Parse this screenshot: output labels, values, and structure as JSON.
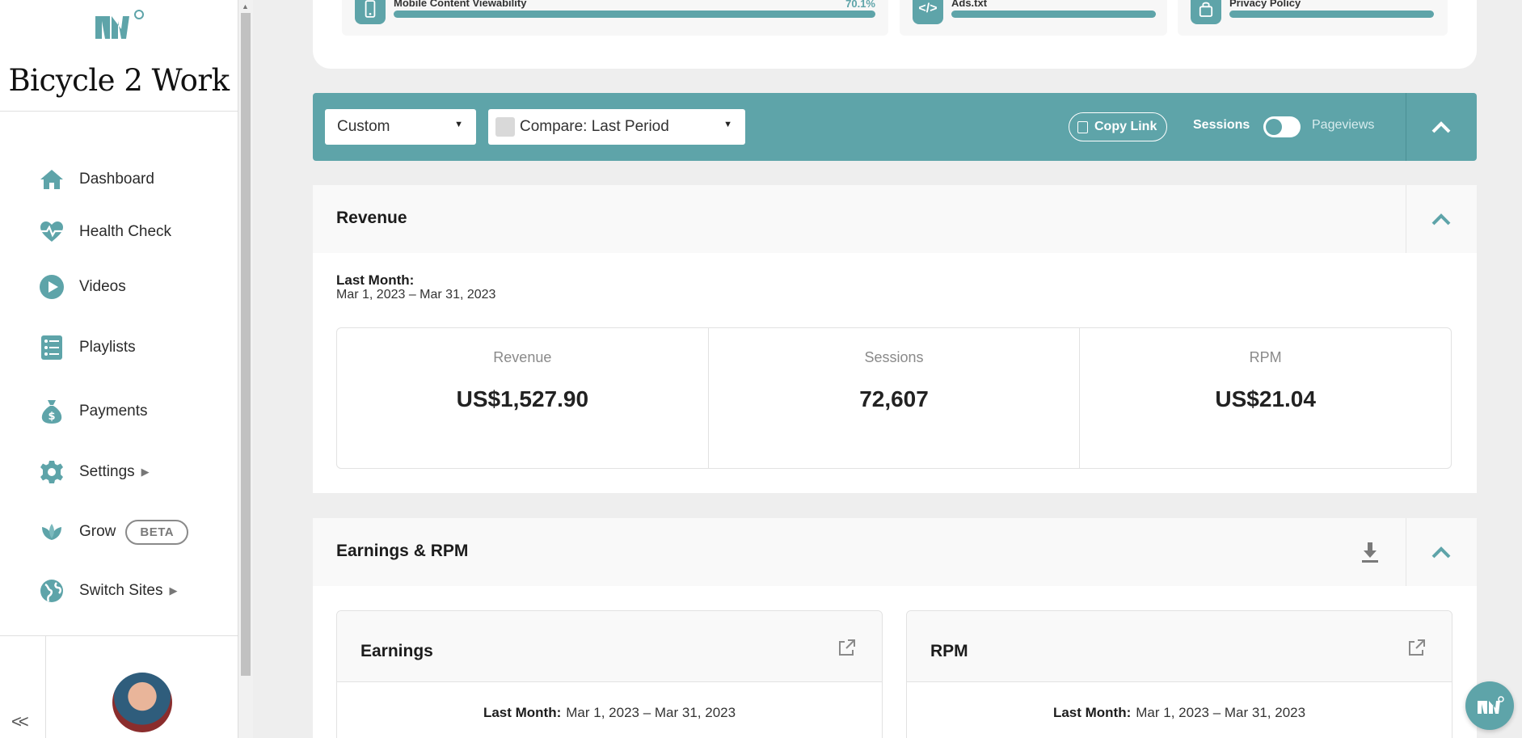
{
  "brand": {
    "name": "Bicycle 2 Work"
  },
  "sidebar": {
    "items": [
      {
        "label": "Dashboard",
        "icon": "home-icon"
      },
      {
        "label": "Health Check",
        "icon": "heartbeat-icon"
      },
      {
        "label": "Videos",
        "icon": "play-icon"
      },
      {
        "label": "Playlists",
        "icon": "list-icon"
      },
      {
        "label": "Payments",
        "icon": "money-bag-icon"
      },
      {
        "label": "Settings",
        "icon": "gear-icon",
        "caret": "▶"
      },
      {
        "label": "Grow",
        "icon": "leaf-icon",
        "badge": "BETA"
      },
      {
        "label": "Switch Sites",
        "icon": "globe-icon",
        "caret": "▶"
      }
    ],
    "collapse_label": "<<"
  },
  "health_tiles": [
    {
      "title": "Mobile Content Viewability",
      "score": "70.1%",
      "icon": "mobile-icon"
    },
    {
      "title": "Ads.txt",
      "icon": "code-icon"
    },
    {
      "title": "Privacy Policy",
      "icon": "lock-icon"
    }
  ],
  "filters": {
    "range_select": "Custom",
    "compare_select": "Compare: Last Period",
    "copy_link_label": "Copy Link",
    "toggle_on_label": "Sessions",
    "toggle_off_label": "Pageviews"
  },
  "revenue_panel": {
    "title": "Revenue",
    "period_label": "Last Month:",
    "period_range": "Mar 1, 2023 – Mar 31, 2023",
    "stats": [
      {
        "label": "Revenue",
        "value": "US$1,527.90"
      },
      {
        "label": "Sessions",
        "value": "72,607"
      },
      {
        "label": "RPM",
        "value": "US$21.04"
      }
    ]
  },
  "earnings_panel": {
    "title": "Earnings & RPM",
    "cards": [
      {
        "title": "Earnings",
        "period_label": "Last Month:",
        "period_range": "Mar 1, 2023 – Mar 31, 2023"
      },
      {
        "title": "RPM",
        "period_label": "Last Month:",
        "period_range": "Mar 1, 2023 – Mar 31, 2023"
      }
    ]
  },
  "colors": {
    "accent": "#5ea4a9",
    "sidebar_bg": "#ffffff",
    "page_bg": "#eeeeee"
  }
}
